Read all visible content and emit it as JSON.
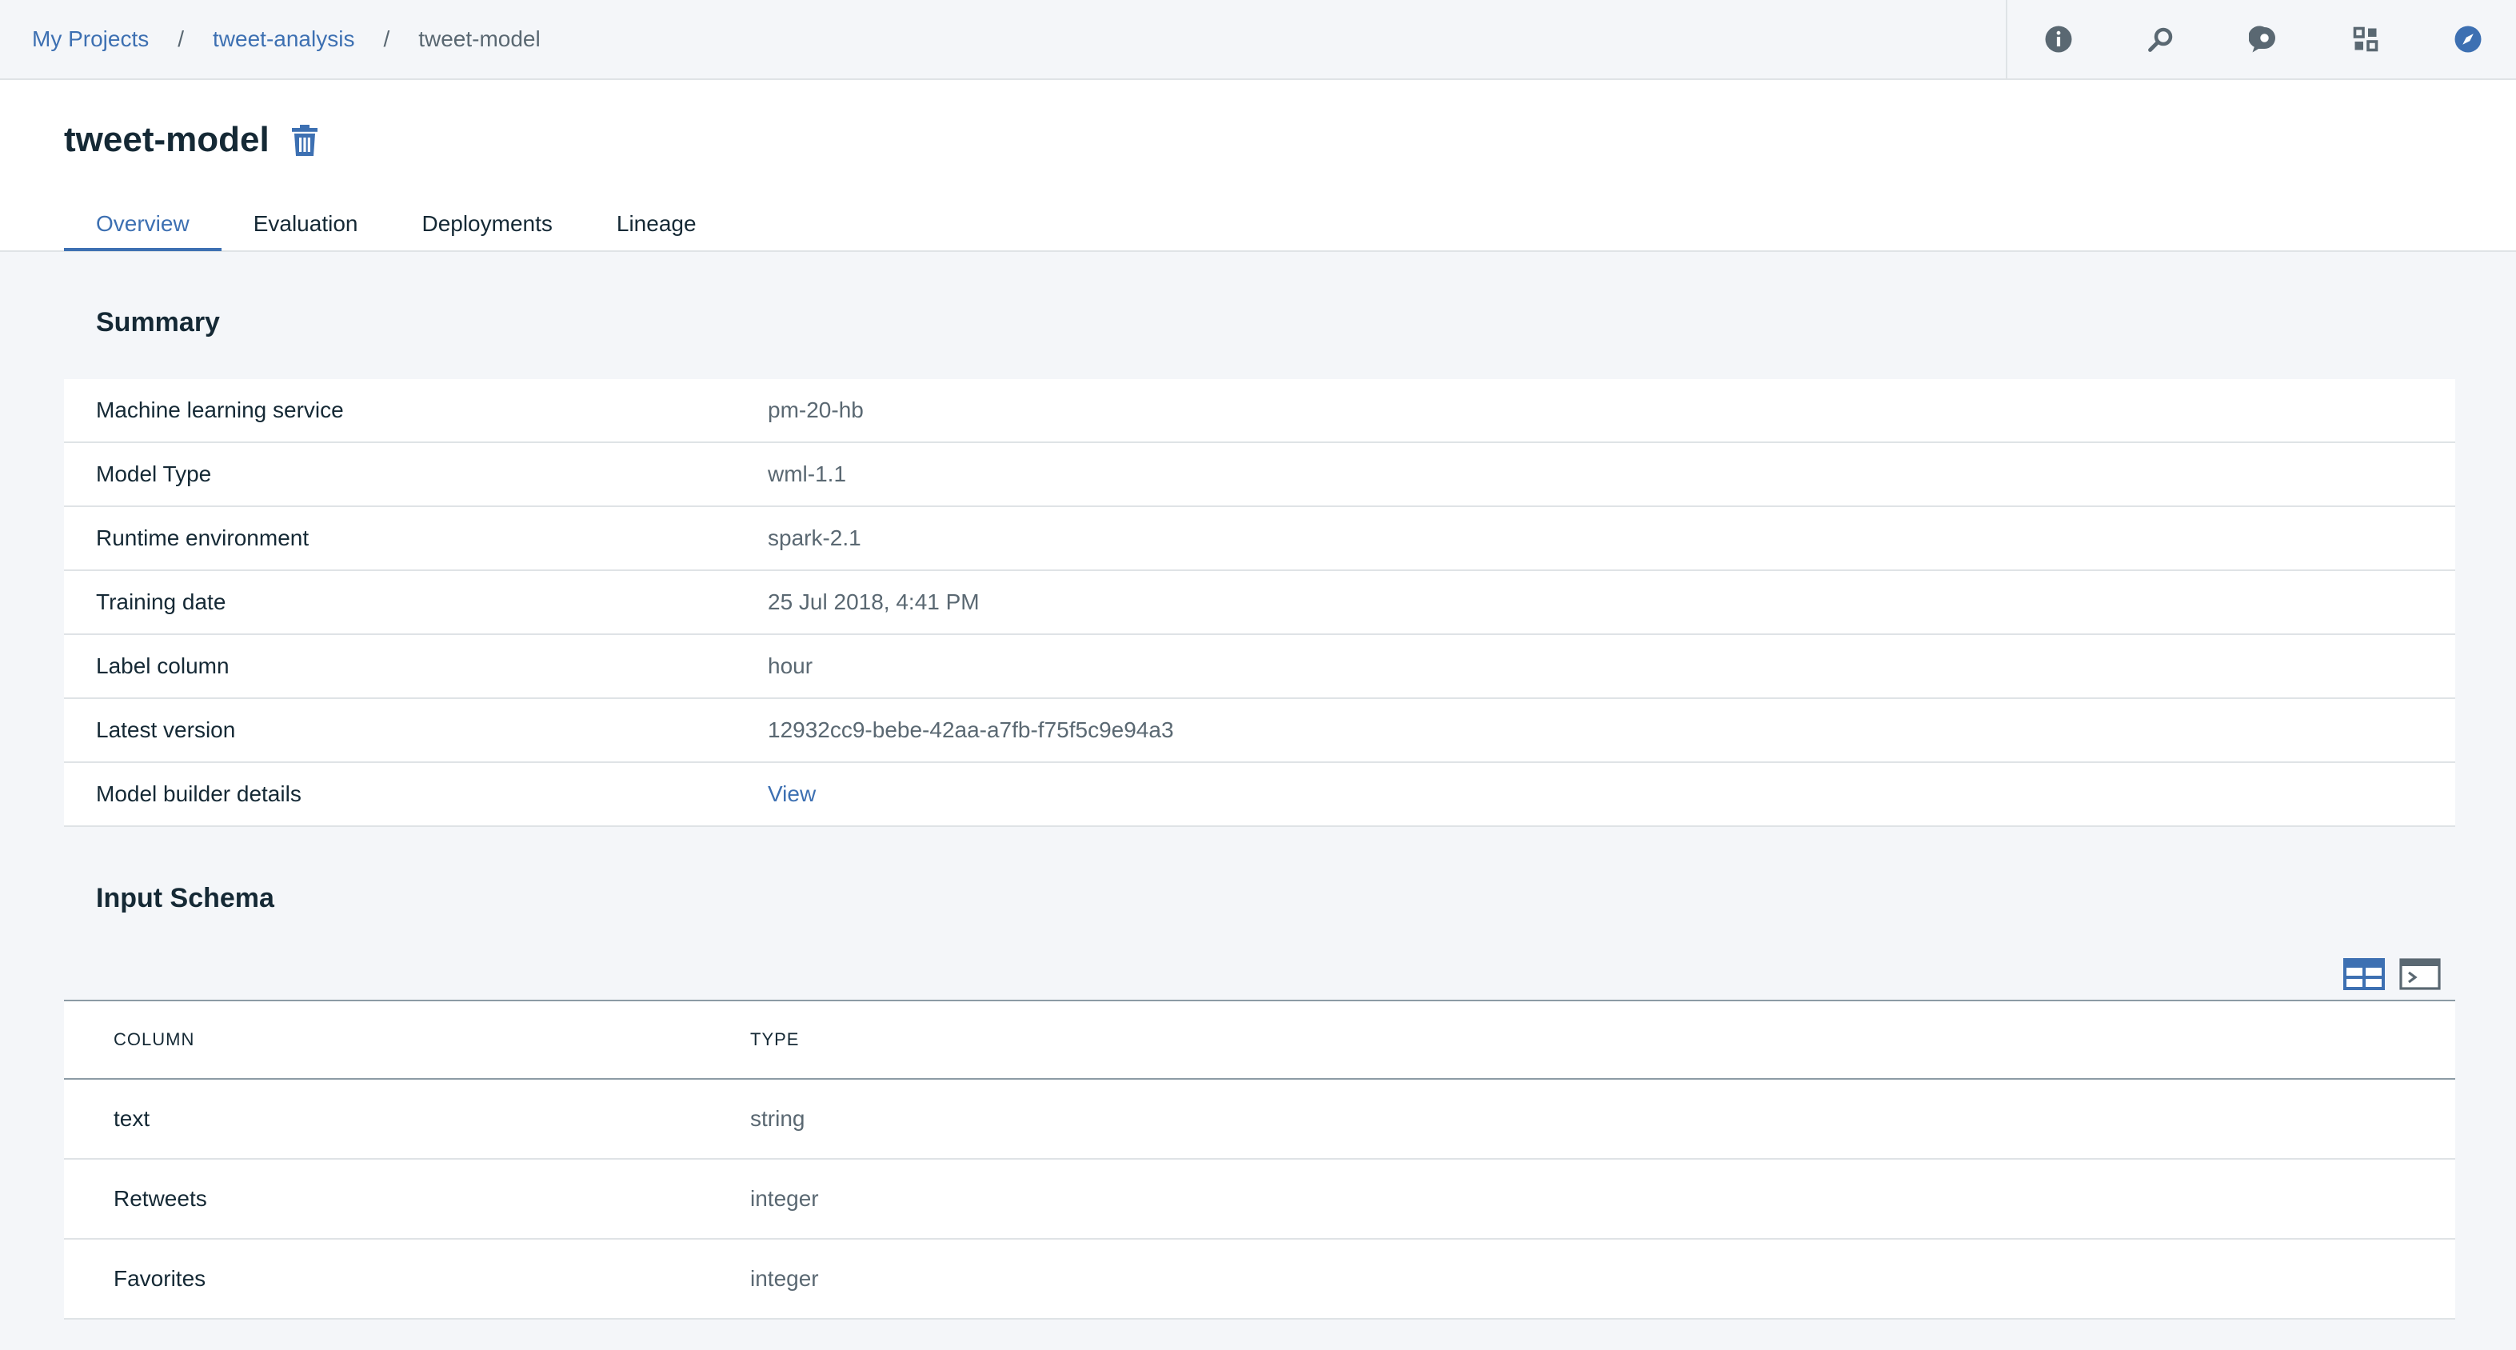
{
  "breadcrumb": {
    "items": [
      "My Projects",
      "tweet-analysis"
    ],
    "separator": "/",
    "current": "tweet-model"
  },
  "toolbar": {
    "icons": [
      "info-icon",
      "search-assets-icon",
      "chat-icon",
      "apps-grid-icon",
      "compass-icon"
    ]
  },
  "header": {
    "title": "tweet-model",
    "tabs": [
      {
        "label": "Overview",
        "active": true
      },
      {
        "label": "Evaluation",
        "active": false
      },
      {
        "label": "Deployments",
        "active": false
      },
      {
        "label": "Lineage",
        "active": false
      }
    ]
  },
  "summary": {
    "title": "Summary",
    "rows": [
      {
        "label": "Machine learning service",
        "value": "pm-20-hb"
      },
      {
        "label": "Model Type",
        "value": "wml-1.1"
      },
      {
        "label": "Runtime environment",
        "value": "spark-2.1"
      },
      {
        "label": "Training date",
        "value": "25 Jul 2018, 4:41 PM"
      },
      {
        "label": "Label column",
        "value": "hour"
      },
      {
        "label": "Latest version",
        "value": "12932cc9-bebe-42aa-a7fb-f75f5c9e94a3"
      },
      {
        "label": "Model builder details",
        "value": "View"
      }
    ]
  },
  "input_schema": {
    "title": "Input Schema",
    "view_icons": [
      "table-view-icon",
      "code-view-icon"
    ],
    "columns": [
      "COLUMN",
      "TYPE"
    ],
    "rows": [
      [
        "text",
        "string"
      ],
      [
        "Retweets",
        "integer"
      ],
      [
        "Favorites",
        "integer"
      ]
    ]
  },
  "colors": {
    "accent": "#3d70b2",
    "text": "#152935",
    "muted": "#5a6872",
    "border": "#dfe3e6",
    "background": "#f4f6f9"
  }
}
